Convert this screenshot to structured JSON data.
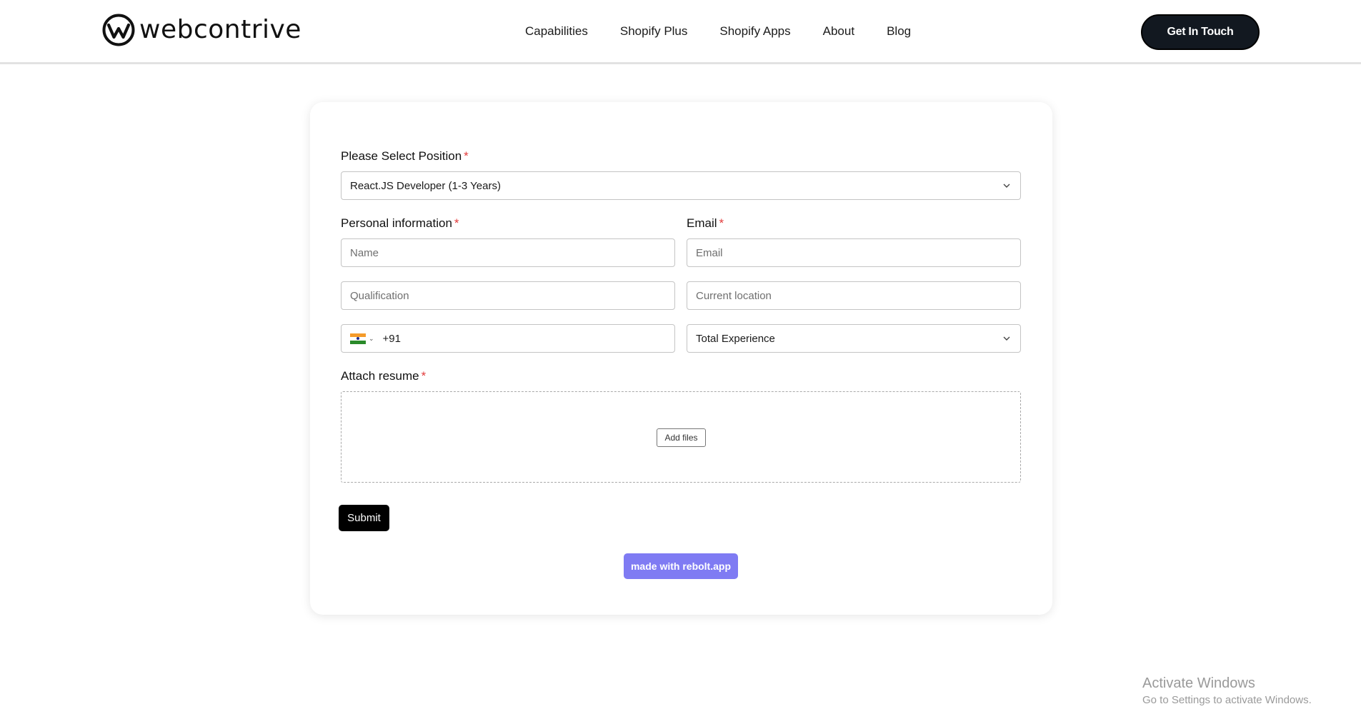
{
  "header": {
    "logo_text": "webcontrive",
    "nav": [
      "Capabilities",
      "Shopify Plus",
      "Shopify Apps",
      "About",
      "Blog"
    ],
    "cta_label": "Get In Touch"
  },
  "form": {
    "position": {
      "label": "Please Select Position",
      "required_mark": "*",
      "value": "React.JS Developer (1-3 Years)"
    },
    "personal": {
      "label": "Personal information",
      "required_mark": "*",
      "name_placeholder": "Name",
      "qualification_placeholder": "Qualification"
    },
    "email": {
      "label": "Email",
      "required_mark": "*",
      "placeholder": "Email",
      "location_placeholder": "Current location"
    },
    "phone": {
      "country_flag": "india-flag",
      "dial_code": "+91"
    },
    "experience": {
      "value": "Total Experience"
    },
    "resume": {
      "label": "Attach resume",
      "required_mark": "*",
      "add_files_label": "Add files"
    },
    "submit_label": "Submit",
    "made_with_label": "made with rebolt.app"
  },
  "colors": {
    "accent": "#7f7bf3",
    "cta_bg": "#121820",
    "required": "#e23b3b"
  },
  "watermark": {
    "line1": "Activate Windows",
    "line2": "Go to Settings to activate Windows."
  }
}
